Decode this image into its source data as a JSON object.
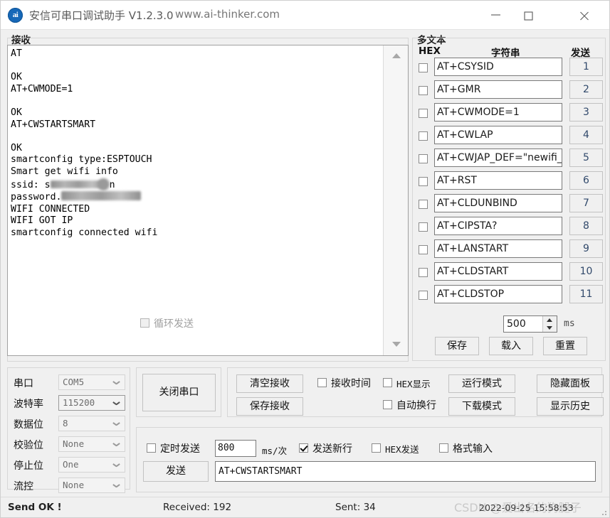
{
  "window": {
    "icon_label": "ai",
    "title": "安信可串口调试助手 V1.2.3.0",
    "url": "www.ai-thinker.com",
    "minimize": "minimize-icon",
    "maximize": "maximize-icon",
    "close": "close-icon"
  },
  "receive": {
    "legend": "接收",
    "lines_before_ssid": "AT\n\nOK\nAT+CWMODE=1\n\nOK\nAT+CWSTARTSMART\n\nOK\nsmartconfig type:ESPTOUCH\nSmart get wifi info\n",
    "ssid_prefix": "ssid: s",
    "ssid_suffix": "n",
    "password_prefix": "password.",
    "lines_after": "WIFI CONNECTED\nWIFI GOT IP\nsmartconfig connected wifi"
  },
  "multitext": {
    "legend": "多文本",
    "col_hex": "HEX",
    "col_string": "字符串",
    "col_send": "发送",
    "rows": [
      {
        "command": "AT+CSYSID",
        "send": "1",
        "checked": false
      },
      {
        "command": "AT+GMR",
        "send": "2",
        "checked": false
      },
      {
        "command": "AT+CWMODE=1",
        "send": "3",
        "checked": false
      },
      {
        "command": "AT+CWLAP",
        "send": "4",
        "checked": false
      },
      {
        "command": "AT+CWJAP_DEF=\"newifi_",
        "send": "5",
        "checked": false
      },
      {
        "command": "AT+RST",
        "send": "6",
        "checked": false
      },
      {
        "command": "AT+CLDUNBIND",
        "send": "7",
        "checked": false
      },
      {
        "command": "AT+CIPSTA?",
        "send": "8",
        "checked": false
      },
      {
        "command": "AT+LANSTART",
        "send": "9",
        "checked": false
      },
      {
        "command": "AT+CLDSTART",
        "send": "10",
        "checked": false
      },
      {
        "command": "AT+CLDSTOP",
        "send": "11",
        "checked": false
      }
    ],
    "loop_send_label": "循环发送",
    "loop_send_checked": false,
    "loop_interval": "500",
    "loop_unit": "ms",
    "save_label": "保存",
    "load_label": "载入",
    "reset_label": "重置"
  },
  "serial": {
    "fields": [
      {
        "label": "串口",
        "value": "COM5"
      },
      {
        "label": "波特率",
        "value": "115200"
      },
      {
        "label": "数据位",
        "value": "8"
      },
      {
        "label": "校验位",
        "value": "None"
      },
      {
        "label": "停止位",
        "value": "One"
      },
      {
        "label": "流控",
        "value": "None"
      }
    ],
    "close_port_label": "关闭串口"
  },
  "controls": {
    "clear_recv_label": "清空接收",
    "save_recv_label": "保存接收",
    "recv_time_label": "接收时间",
    "recv_time_checked": false,
    "hex_display_label": "HEX显示",
    "hex_display_checked": false,
    "auto_wrap_label": "自动换行",
    "auto_wrap_checked": false,
    "run_mode_label": "运行模式",
    "download_mode_label": "下载模式",
    "hide_panel_label": "隐藏面板",
    "show_history_label": "显示历史"
  },
  "send": {
    "timed_send_label": "定时发送",
    "timed_send_checked": false,
    "interval_value": "800",
    "interval_unit": "ms/次",
    "newline_label": "发送新行",
    "newline_checked": true,
    "hex_send_label": "HEX发送",
    "hex_send_checked": false,
    "format_input_label": "格式输入",
    "format_input_checked": false,
    "send_button_label": "发送",
    "send_text": "AT+CWSTARTSMART"
  },
  "status": {
    "send_ok": "Send OK !",
    "received": "Received: 192",
    "sent": "Sent: 34",
    "timestamp": "2022-09-25 15:58:53",
    "watermark": "CSDN @爱出名的狗腿子"
  }
}
